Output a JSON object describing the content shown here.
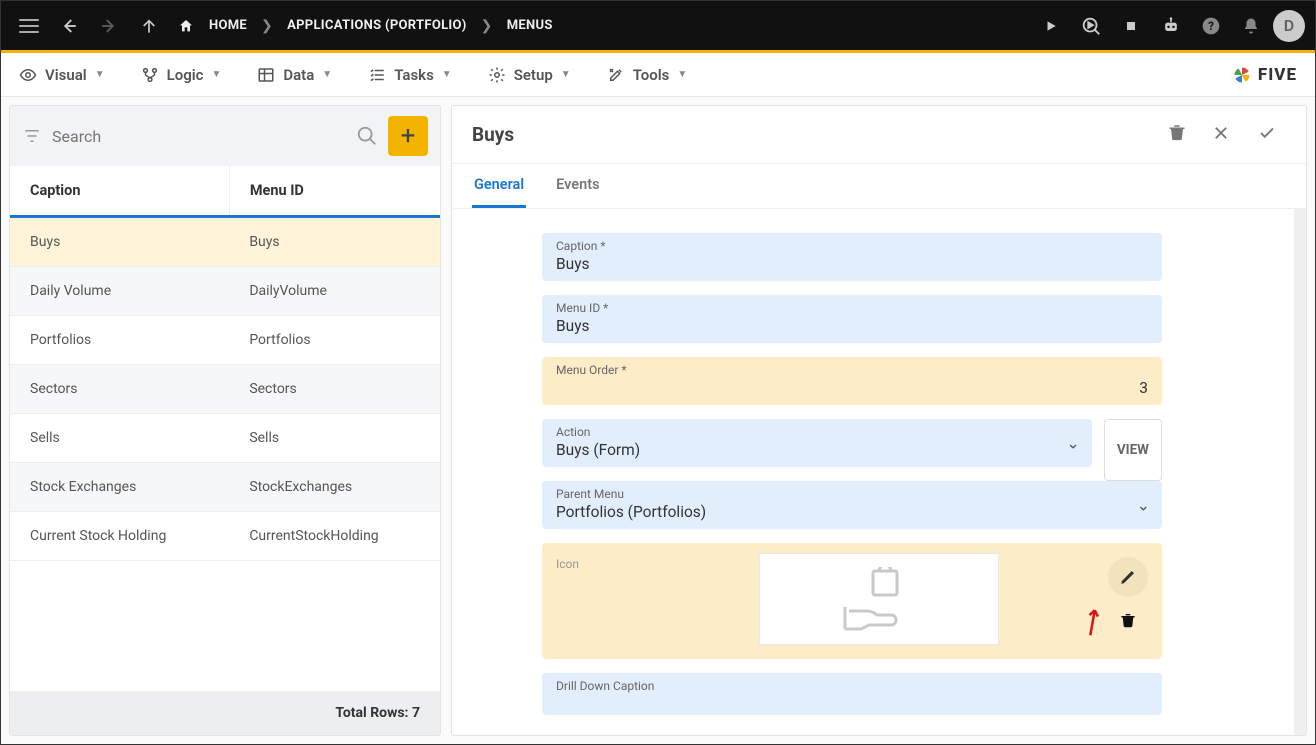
{
  "topbar": {
    "home": "HOME",
    "crumb2": "APPLICATIONS (PORTFOLIO)",
    "crumb3": "MENUS",
    "avatar_initial": "D"
  },
  "menubar": {
    "items": [
      {
        "label": "Visual"
      },
      {
        "label": "Logic"
      },
      {
        "label": "Data"
      },
      {
        "label": "Tasks"
      },
      {
        "label": "Setup"
      },
      {
        "label": "Tools"
      }
    ],
    "logo_text": "FIVE"
  },
  "left": {
    "search_placeholder": "Search",
    "cols": {
      "caption": "Caption",
      "menuid": "Menu ID"
    },
    "rows": [
      {
        "caption": "Buys",
        "menuid": "Buys",
        "selected": true
      },
      {
        "caption": "Daily Volume",
        "menuid": "DailyVolume"
      },
      {
        "caption": "Portfolios",
        "menuid": "Portfolios"
      },
      {
        "caption": "Sectors",
        "menuid": "Sectors"
      },
      {
        "caption": "Sells",
        "menuid": "Sells"
      },
      {
        "caption": "Stock Exchanges",
        "menuid": "StockExchanges"
      },
      {
        "caption": "Current Stock Holding",
        "menuid": "CurrentStockHolding"
      }
    ],
    "footer": "Total Rows: 7"
  },
  "right": {
    "title": "Buys",
    "tabs": {
      "general": "General",
      "events": "Events"
    },
    "fields": {
      "caption_label": "Caption *",
      "caption_value": "Buys",
      "menuid_label": "Menu ID *",
      "menuid_value": "Buys",
      "order_label": "Menu Order *",
      "order_value": "3",
      "action_label": "Action",
      "action_value": "Buys (Form)",
      "view_btn": "VIEW",
      "parent_label": "Parent Menu",
      "parent_value": "Portfolios (Portfolios)",
      "icon_label": "Icon",
      "drill_label": "Drill Down Caption"
    }
  }
}
